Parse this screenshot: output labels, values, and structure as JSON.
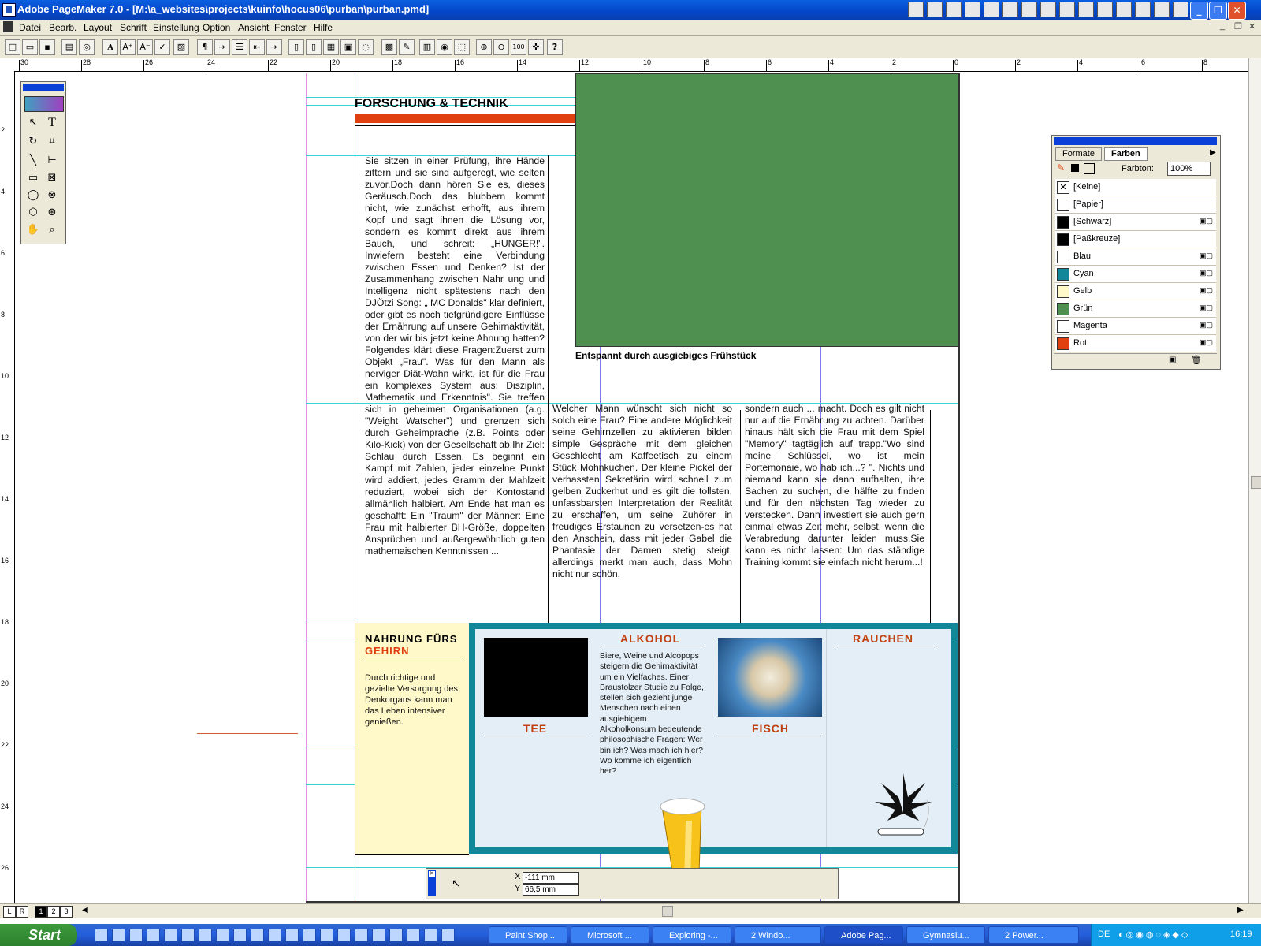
{
  "window": {
    "title": "Adobe PageMaker 7.0 - [M:\\a_websites\\projects\\kuinfo\\hocus06\\purban\\purban.pmd]",
    "minimize": "_",
    "maximize": "❐",
    "close": "✕"
  },
  "menu": [
    "Datei",
    "Bearb.",
    "Layout",
    "Schrift",
    "Einstellung",
    "Option",
    "Ansicht",
    "Fenster",
    "Hilfe"
  ],
  "ruler": {
    "h_ticks": [
      "30",
      "28",
      "26",
      "24",
      "22",
      "20",
      "18",
      "16",
      "14",
      "12",
      "10",
      "8",
      "6",
      "4",
      "2",
      "0",
      "2",
      "4",
      "6",
      "8"
    ],
    "v_ticks": [
      "2",
      "4",
      "6",
      "8",
      "10",
      "12",
      "14",
      "16",
      "18",
      "20",
      "22",
      "24",
      "26"
    ]
  },
  "article": {
    "section_title": "FORSCHUNG & TECHNIK",
    "column1": "Sie sitzen in einer Prüfung, ihre Hände zittern und sie sind aufgeregt, wie selten zuvor.Doch dann hören Sie es, dieses Geräusch.Doch das blubbern kommt nicht, wie zunächst erhofft, aus ihrem Kopf und sagt ihnen die Lösung vor, sondern es kommt direkt aus ihrem Bauch, und schreit: „HUNGER!\". Inwiefern besteht eine Verbindung zwischen Essen und Denken? Ist der Zusammenhang zwischen Nahr ung und Intelligenz nicht spätestens nach den DJÖtzi Song: „ MC Donalds\" klar definiert, oder gibt es noch tiefgründigere Einflüsse der Ernährung auf unsere Gehirnaktivität, von der wir bis jetzt keine Ahnung hatten? Folgendes klärt diese Fragen:Zuerst zum Objekt „Frau\". Was für den Mann als nerviger Diät-Wahn wirkt, ist für die Frau ein komplexes System aus: Disziplin, Mathematik und Erkenntnis\". Sie treffen sich in geheimen Organisationen (a.g. \"Weight Watscher\") und grenzen sich durch Geheimprache (z.B. Points oder Kilo-Kick) von der Gesellschaft ab.Ihr Ziel: Schlau durch Essen. Es beginnt ein Kampf mit Zahlen, jeder einzelne Punkt wird addiert, jedes Gramm der Mahlzeit reduziert, wobei sich der Kontostand allmählich halbiert. Am Ende hat man es geschafft: Ein \"Traum\" der Männer: Eine Frau mit halbierter BH-Größe, doppelten Ansprüchen und außergewöhnlich guten mathemaischen Kenntnissen ...",
    "column2": "Welcher Mann wünscht sich nicht so solch eine Frau? Eine andere Möglichkeit seine Gehirnzellen zu aktivieren bilden simple Gespräche mit dem gleichen Geschlecht am Kaffeetisch zu einem Stück Mohnkuchen. Der kleine Pickel der verhassten Sekretärin wird schnell zum gelben Zuckerhut und es gilt die tollsten, unfassbarsten Interpretation der Realität zu erschaffen, um seine Zuhörer in freudiges Erstaunen zu versetzen-es hat den Anschein, dass mit jeder Gabel die Phantasie der Damen stetig steigt, allerdings merkt man auch, dass Mohn nicht nur schön,",
    "column3": "sondern auch ... macht. Doch es gilt nicht nur auf die Ernährung zu achten. Darüber hinaus hält sich die Frau mit dem Spiel \"Memory\" tagtäglich auf trapp.\"Wo sind meine Schlüssel, wo ist mein Portemonaie, wo hab ich...? \". Nichts und niemand kann sie dann aufhalten, ihre Sachen zu suchen, die hälfte zu finden und für den nächsten Tag wieder zu verstecken. Dann investiert sie auch gern einmal etwas Zeit mehr, selbst, wenn die Verabredung darunter leiden muss.Sie kann es nicht lassen: Um das ständige Training kommt sie einfach nicht herum...!",
    "photo_caption": "Entspannt durch ausgiebiges Frühstück"
  },
  "infobox": {
    "title_line1": "NAHRUNG FÜRS",
    "title_line2": "GEHIRN",
    "intro": "Durch richtige und gezielte Versorgung des Denkorgans kann man das Leben intensiver genießen.",
    "tee": "TEE",
    "alkohol": "ALKOHOL",
    "alkohol_text": "Biere, Weine und Alcopops steigern die Gehirnaktivität um ein Vielfaches. Einer Braustolzer Studie zu Folge, stellen sich gezieht junge Menschen nach einen ausgiebigem Alkoholkonsum bedeutende philosophische Fragen: Wer bin ich? Was mach ich hier? Wo komme ich eigentlich her?",
    "fisch": "FISCH",
    "rauchen": "RAUCHEN"
  },
  "palette": {
    "tab_formate": "Formate",
    "tab_farben": "Farben",
    "farbton_label": "Farbton:",
    "farbton_value": "100%",
    "colors": [
      {
        "name": "[Keine]",
        "hex": "#ffffff"
      },
      {
        "name": "[Papier]",
        "hex": "#ffffff"
      },
      {
        "name": "[Schwarz]",
        "hex": "#000000"
      },
      {
        "name": "[Paßkreuze]",
        "hex": "#000000"
      },
      {
        "name": "Blau",
        "hex": "#ffffff"
      },
      {
        "name": "Cyan",
        "hex": "#13879a"
      },
      {
        "name": "Gelb",
        "hex": "#fff8c8"
      },
      {
        "name": "Grün",
        "hex": "#4f8f50"
      },
      {
        "name": "Magenta",
        "hex": "#ffffff"
      },
      {
        "name": "Rot",
        "hex": "#e04010"
      }
    ]
  },
  "coords": {
    "x_label": "X",
    "x_value": "-111 mm",
    "y_label": "Y",
    "y_value": "66,5 mm"
  },
  "pagetabs": [
    "L",
    "R",
    "1",
    "2",
    "3"
  ],
  "taskbar": {
    "start": "Start",
    "tasks": [
      "Paint Shop...",
      "Microsoft ...",
      "Exploring -...",
      "2 Windo...",
      "Adobe Pag...",
      "Gymnasiu...",
      "2 Power..."
    ],
    "lang": "DE",
    "clock": "16:19"
  },
  "colors": {
    "accent_orange": "#e04010",
    "photo_green": "#4f8f50",
    "box_teal": "#13879a",
    "box_yellow": "#fff8c8",
    "box_lightblue": "#e4eef6",
    "title_blue": "#0a5fe0"
  }
}
